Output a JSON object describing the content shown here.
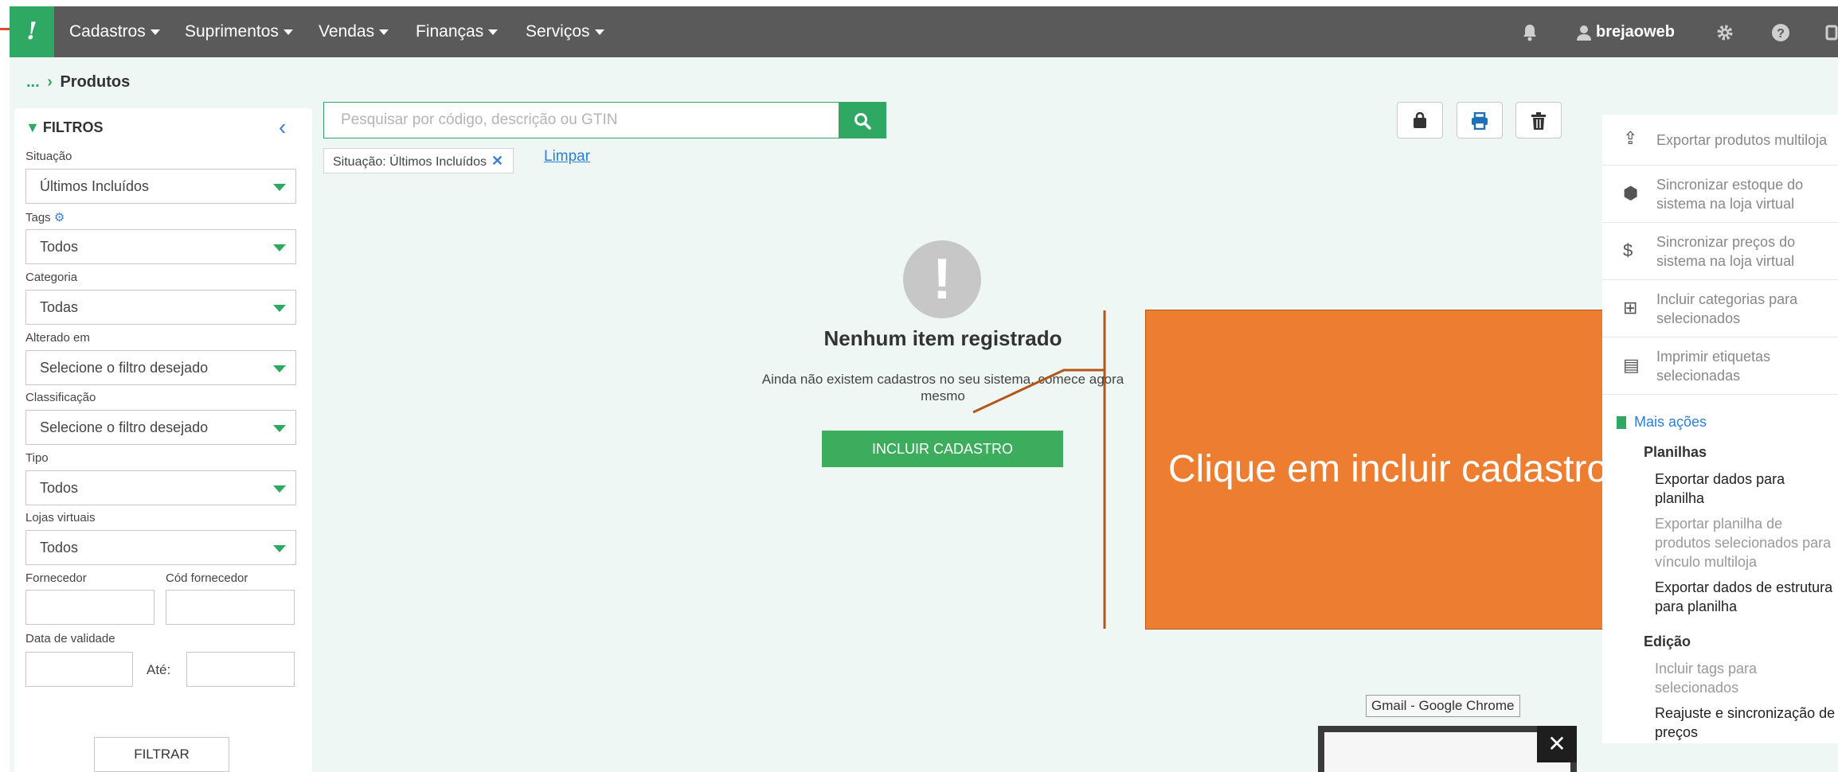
{
  "topbar": {
    "logo": "!",
    "menus": [
      "Cadastros",
      "Suprimentos",
      "Vendas",
      "Finanças",
      "Serviços"
    ],
    "user": "brejaoweb"
  },
  "breadcrumb": {
    "prefix": "...",
    "current": "Produtos"
  },
  "filters": {
    "title": "FILTROS",
    "situacao_label": "Situação",
    "situacao_value": "Últimos Incluídos",
    "tags_label": "Tags",
    "tags_value": "Todos",
    "categoria_label": "Categoria",
    "categoria_value": "Todas",
    "alterado_label": "Alterado em",
    "alterado_value": "Selecione o filtro desejado",
    "classificacao_label": "Classificação",
    "classificacao_value": "Selecione o filtro desejado",
    "tipo_label": "Tipo",
    "tipo_value": "Todos",
    "lojas_label": "Lojas virtuais",
    "lojas_value": "Todos",
    "fornecedor_label": "Fornecedor",
    "cod_fornecedor_label": "Cód fornecedor",
    "validade_label": "Data de validade",
    "ate_label": "Até:",
    "filtrar_label": "FILTRAR"
  },
  "search": {
    "placeholder": "Pesquisar por código, descrição ou GTIN"
  },
  "active_filter": {
    "chip": "Situação: Últimos Incluídos",
    "clear": "Limpar"
  },
  "empty_state": {
    "icon": "!",
    "title": "Nenhum item registrado",
    "description": "Ainda não existem cadastros no seu sistema, comece agora mesmo",
    "button": "INCLUIR CADASTRO"
  },
  "annotation": {
    "text": "Clique em incluir cadastro"
  },
  "actions": {
    "export_multiloja": "Exportar produtos multiloja",
    "sync_estoque": "Sincronizar estoque do sistema na loja virtual",
    "sync_precos": "Sincronizar preços do sistema na loja virtual",
    "incluir_categorias": "Incluir categorias para selecionados",
    "imprimir_etiquetas": "Imprimir etiquetas selecionadas",
    "mais_acoes": "Mais ações",
    "planilhas_head": "Planilhas",
    "exportar_dados": "Exportar dados para planilha",
    "exportar_planilha_multiloja": "Exportar planilha de produtos selecionados para vínculo multiloja",
    "exportar_estrutura": "Exportar dados de estrutura para planilha",
    "edicao_head": "Edição",
    "incluir_tags": "Incluir tags para selecionados",
    "reajuste": "Reajuste e sincronização de preços"
  },
  "taskbar": {
    "tooltip": "Gmail - Google Chrome",
    "close": "✕"
  }
}
